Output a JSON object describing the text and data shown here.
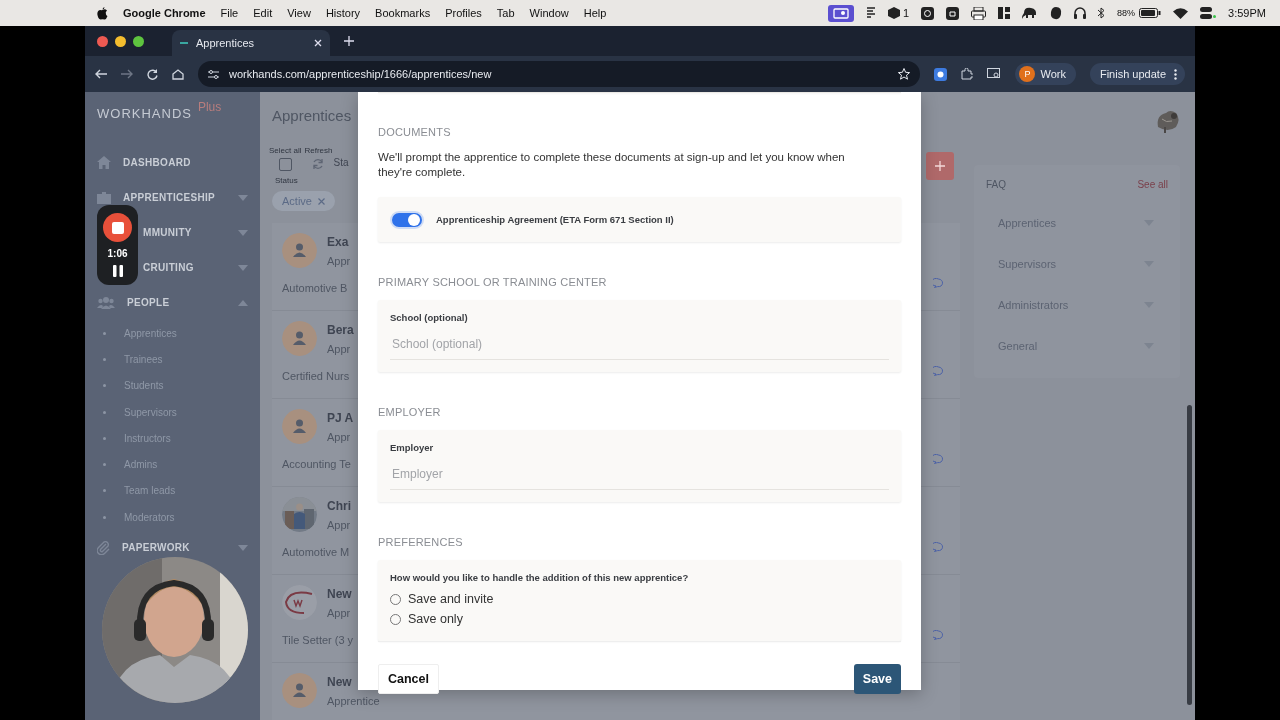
{
  "menubar": {
    "app": "Google Chrome",
    "menus": [
      "File",
      "Edit",
      "View",
      "History",
      "Bookmarks",
      "Profiles",
      "Tab",
      "Window",
      "Help"
    ],
    "badge_count": "1",
    "battery": "88%",
    "time": "3:59PM"
  },
  "browser": {
    "tab": {
      "title": "Apprentices"
    },
    "url": "workhands.com/apprenticeship/1666/apprentices/new",
    "profile": {
      "initial": "P",
      "name": "Work"
    },
    "update_button": "Finish update"
  },
  "sidebar": {
    "brand": "WORKHANDS",
    "brand_tier": "Plus",
    "items": [
      {
        "label": "DASHBOARD",
        "kind": "link"
      },
      {
        "label": "APPRENTICESHIP",
        "kind": "group",
        "expanded": false
      },
      {
        "label": "MMUNITY",
        "kind": "group",
        "expanded": false
      },
      {
        "label": "CRUITING",
        "kind": "group",
        "expanded": false
      },
      {
        "label": "PEOPLE",
        "kind": "group",
        "expanded": true,
        "children": [
          {
            "label": "Apprentices"
          },
          {
            "label": "Trainees"
          },
          {
            "label": "Students"
          },
          {
            "label": "Supervisors"
          },
          {
            "label": "Instructors"
          },
          {
            "label": "Admins"
          },
          {
            "label": "Team leads"
          },
          {
            "label": "Moderators"
          }
        ]
      },
      {
        "label": "PAPERWORK",
        "kind": "group",
        "expanded": false
      }
    ]
  },
  "recorder": {
    "elapsed": "1:06"
  },
  "main": {
    "title": "Apprentices",
    "toolbar": {
      "select_all": "Select all",
      "checked": false,
      "refresh": "Refresh",
      "status_cut": "Sta",
      "status_label": "Status"
    },
    "filter_chips": [
      {
        "label": "Active"
      }
    ],
    "people": [
      {
        "name": "Exa",
        "role": "Appr",
        "detail": "Automotive B",
        "kind": "placeholder"
      },
      {
        "name": "Bera",
        "role": "Appr",
        "detail": "Certified Nurs",
        "kind": "placeholder"
      },
      {
        "name": "PJ A",
        "role": "Appr",
        "detail": "Accounting Te",
        "kind": "placeholder"
      },
      {
        "name": "Chri",
        "role": "Appr",
        "detail": "Automotive M"
      },
      {
        "name": "New",
        "role": "Appr",
        "detail": "Tile Setter (3 y",
        "kind": "logo"
      },
      {
        "name": "New",
        "role": "Apprentice",
        "kind": "placeholder"
      }
    ]
  },
  "faq": {
    "title": "FAQ",
    "see_all": "See all",
    "items": [
      {
        "label": "Apprentices",
        "expanded": false
      },
      {
        "label": "Supervisors",
        "expanded": false
      },
      {
        "label": "Administrators",
        "expanded": false
      },
      {
        "label": "General",
        "expanded": false
      }
    ]
  },
  "modal": {
    "sections": [
      {
        "kind": "documents",
        "heading": "DOCUMENTS",
        "description": "We'll prompt the apprentice to complete these documents at sign-up and let you know when they're complete.",
        "documents": [
          {
            "label": "Apprenticeship Agreement (ETA Form 671 Section II)",
            "on": true
          }
        ]
      },
      {
        "kind": "field",
        "heading": "PRIMARY SCHOOL OR TRAINING CENTER",
        "field": {
          "label": "School (optional)",
          "placeholder": "School (optional)"
        }
      },
      {
        "kind": "field",
        "heading": "EMPLOYER",
        "field": {
          "label": "Employer",
          "placeholder": "Employer"
        }
      },
      {
        "kind": "choice",
        "heading": "PREFERENCES",
        "question": "How would you like to handle the addition of this new apprentice?",
        "options": [
          {
            "label": "Save and invite",
            "selected": false
          },
          {
            "label": "Save only",
            "selected": false
          }
        ]
      }
    ],
    "cancel": "Cancel",
    "save": "Save"
  }
}
